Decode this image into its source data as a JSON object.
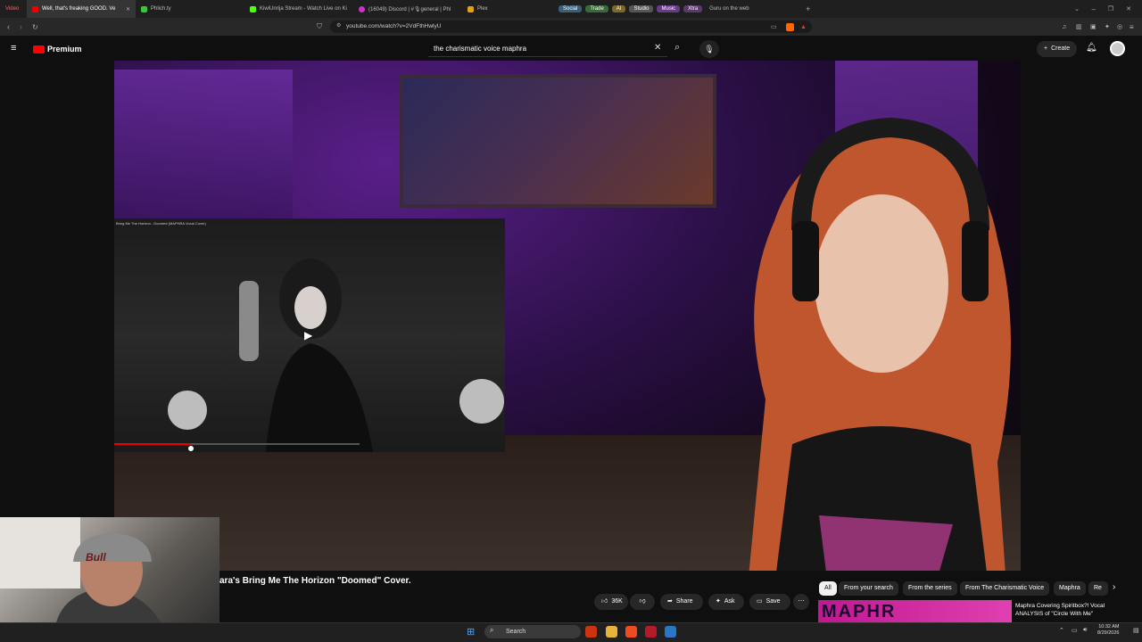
{
  "browser": {
    "tabs": [
      {
        "label": "Video",
        "active": false
      },
      {
        "label": "Well, that's freaking GOOD. Ve",
        "active": true
      },
      {
        "label": "Phlich.ty",
        "active": false
      },
      {
        "label": "KiwiUnrija Stream - Watch Live on Ki",
        "active": false
      },
      {
        "label": "(16049) Discord | #🎙general | Phl",
        "active": false
      },
      {
        "label": "Plex",
        "active": false
      }
    ],
    "groups": [
      {
        "label": "Social",
        "color": "#3b5f7a"
      },
      {
        "label": "Trade",
        "color": "#3a6a3a"
      },
      {
        "label": "AI",
        "color": "#7a6a2a"
      },
      {
        "label": "Studio",
        "color": "#555555"
      },
      {
        "label": "Music",
        "color": "#6a3a8a"
      },
      {
        "label": "Xtra",
        "color": "#5a3a6a"
      }
    ],
    "extra_tab": "Guru on the web",
    "url": "youtube.com/watch?v=2VdFthHwlyU"
  },
  "youtube": {
    "brand": "Premium",
    "search_value": "the charismatic voice maphra",
    "create_label": "Create",
    "video": {
      "inset_title": "Bring Me The Horizon - Doomed (MAPHRA Vocal Cover)",
      "title": "ara's Bring Me The Horizon \"Doomed\" Cover."
    },
    "actions": {
      "like_count": "36K",
      "share": "Share",
      "ask": "Ask",
      "save": "Save"
    },
    "chips": [
      {
        "label": "All",
        "active": true
      },
      {
        "label": "From your search",
        "active": false
      },
      {
        "label": "From the series",
        "active": false
      },
      {
        "label": "From The Charismatic Voice",
        "active": false
      },
      {
        "label": "Maphra",
        "active": false
      },
      {
        "label": "Re",
        "active": false
      }
    ],
    "recommended": {
      "thumb_text": "MAPHR",
      "title": "Maphra Covering Spiritbox?! Vocal ANALYSIS of \"Circle With Me\""
    },
    "webcam_text": "Bull"
  },
  "taskbar": {
    "search_label": "Search",
    "time": "10:32 AM",
    "date": "8/29/2026"
  }
}
